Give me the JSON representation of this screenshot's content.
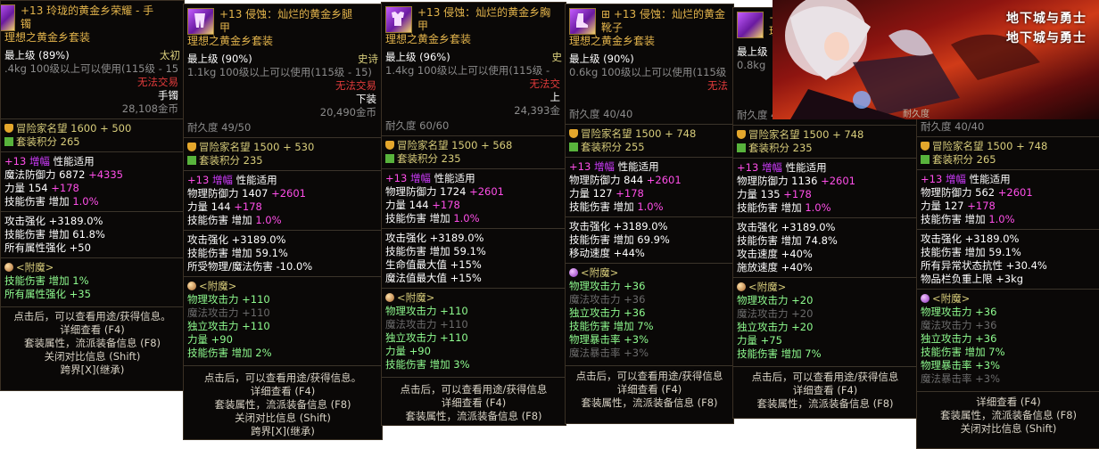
{
  "panels": [
    {
      "title_lines": [
        "+13 玲珑的黄金乡荣耀 - 手",
        "镯"
      ],
      "set_name": "理想之黄金乡套装",
      "level": "最上级 (89%)",
      "rarity": "太初",
      "weight": ".4kg",
      "req": "100级以上可以使用(115级 - 15",
      "trade": "无法交易",
      "slot": "手镯",
      "price": "28,108金币",
      "fame": "冒险家名望 1600 + 500",
      "set_score": "套装积分 265",
      "amp_plus": "+13",
      "amp_label": "增幅",
      "perf": "性能适用",
      "stats": [
        {
          "label": "魔法防御力 6872 ",
          "bonus": "+4335"
        },
        {
          "label": "力量 154 ",
          "bonus": "+178"
        },
        {
          "label": "技能伤害 增加 ",
          "bonus": "1.0%"
        }
      ],
      "effects": [
        "攻击强化 +3189.0%",
        "技能伤害 增加 61.8%",
        "所有属性强化 +50"
      ],
      "enchant_title": "<附魔>",
      "enchants": [
        {
          "text": "技能伤害 增加 1%",
          "dim": false
        },
        {
          "text": "所有属性强化 +35",
          "dim": false
        }
      ],
      "footer": [
        "点击后，可以查看用途/获得信息。",
        "详细查看 (F4)",
        "套装属性，流派装备信息 (F8)",
        "关闭对比信息 (Shift)"
      ],
      "footer_red": "跨界[X](继承)"
    },
    {
      "title_lines": [
        "+13 侵蚀：灿烂的黄金乡腿",
        "甲"
      ],
      "set_name": "理想之黄金乡套装",
      "level": "最上级 (90%)",
      "rarity": "史诗",
      "weight": "1.1kg",
      "req": "100级以上可以使用(115级 - 15)",
      "trade": "无法交易",
      "slot": "下装",
      "price": "20,490金币",
      "durability": "耐久度 49/50",
      "fame": "冒险家名望 1500 + 530",
      "set_score": "套装积分 235",
      "amp_plus": "+13",
      "amp_label": "增幅",
      "perf": "性能适用",
      "stats": [
        {
          "label": "物理防御力 1407 ",
          "bonus": "+2601"
        },
        {
          "label": "力量 144 ",
          "bonus": "+178"
        },
        {
          "label": "技能伤害 增加 ",
          "bonus": "1.0%"
        }
      ],
      "effects": [
        "攻击强化 +3189.0%",
        "技能伤害 增加 59.1%",
        "所受物理/魔法伤害 -10.0%"
      ],
      "enchant_title": "<附魔>",
      "enchants": [
        {
          "text": "物理攻击力 +110",
          "dim": false
        },
        {
          "text": "魔法攻击力 +110",
          "dim": true
        },
        {
          "text": "独立攻击力 +110",
          "dim": false
        },
        {
          "text": "力量 +90",
          "dim": false
        },
        {
          "text": "技能伤害 增加 2%",
          "dim": false
        }
      ],
      "footer": [
        "点击后，可以查看用途/获得信息。",
        "详细查看 (F4)",
        "套装属性，流派装备信息 (F8)",
        "关闭对比信息 (Shift)"
      ],
      "footer_red": "跨界[X](继承)"
    },
    {
      "title_lines": [
        "+13 侵蚀：灿烂的黄金乡胸",
        "甲"
      ],
      "set_name": "理想之黄金乡套装",
      "level": "最上级 (96%)",
      "rarity": "史",
      "weight": "1.4kg",
      "req": "100级以上可以使用(115级 -",
      "trade": "无法交",
      "slot": "上",
      "price": "24,393金",
      "durability": "耐久度 60/60",
      "fame": "冒险家名望 1500 + 568",
      "set_score": "套装积分 235",
      "amp_plus": "+13",
      "amp_label": "增幅",
      "perf": "性能适用",
      "stats": [
        {
          "label": "物理防御力 1724 ",
          "bonus": "+2601"
        },
        {
          "label": "力量 144 ",
          "bonus": "+178"
        },
        {
          "label": "技能伤害 增加 ",
          "bonus": "1.0%"
        }
      ],
      "effects": [
        "攻击强化 +3189.0%",
        "技能伤害 增加 59.1%",
        "生命值最大值 +15%",
        "魔法值最大值 +15%"
      ],
      "enchant_title": "<附魔>",
      "enchants": [
        {
          "text": "物理攻击力 +110",
          "dim": false
        },
        {
          "text": "魔法攻击力 +110",
          "dim": true
        },
        {
          "text": "独立攻击力 +110",
          "dim": false
        },
        {
          "text": "力量 +90",
          "dim": false
        },
        {
          "text": "技能伤害 增加 3%",
          "dim": false
        }
      ],
      "footer": [
        "点击后，可以查看用途/获得信息",
        "详细查看 (F4)",
        "套装属性，流派装备信息 (F8)"
      ],
      "footer_red": ""
    },
    {
      "title_lines": [
        "⊞ +13 侵蚀：灿烂的黄金",
        "靴子"
      ],
      "set_name": "理想之黄金乡套装",
      "level": "最上级 (90%)",
      "rarity": "",
      "weight": "0.6kg",
      "req": "100级以上可以使用(115级",
      "trade": "无法",
      "slot": "",
      "price": "",
      "durability": "耐久度 40/40",
      "fame": "冒险家名望 1500 + 748",
      "set_score": "套装积分 255",
      "amp_plus": "+13",
      "amp_label": "增幅",
      "perf": "性能适用",
      "stats": [
        {
          "label": "物理防御力 844 ",
          "bonus": "+2601"
        },
        {
          "label": "力量 127 ",
          "bonus": "+178"
        },
        {
          "label": "技能伤害 增加 ",
          "bonus": "1.0%"
        }
      ],
      "effects": [
        "攻击强化 +3189.0%",
        "技能伤害 增加 69.9%",
        "移动速度 +44%"
      ],
      "enchant_title": "<附魔>",
      "enchants": [
        {
          "text": "物理攻击力 +36",
          "dim": false
        },
        {
          "text": "魔法攻击力 +36",
          "dim": true
        },
        {
          "text": "独立攻击力 +36",
          "dim": false
        },
        {
          "text": "技能伤害 增加 7%",
          "dim": false
        },
        {
          "text": "物理暴击率 +3%",
          "dim": false
        },
        {
          "text": "魔法暴击率 +3%",
          "dim": true
        }
      ],
      "footer": [
        "点击后，可以查看用途/获得信息",
        "详细查看 (F4)",
        "套装属性，流派装备信息 (F8)"
      ],
      "footer_red": ""
    },
    {
      "title_lines": [
        "+",
        "理"
      ],
      "set_name": "",
      "level": "最上级",
      "rarity": "",
      "weight": "0.8kg",
      "req": "",
      "trade": "无法",
      "slot": "",
      "price": "",
      "durability": "耐久度 48/48",
      "fame": "冒险家名望 1500 + 748",
      "set_score": "套装积分 235",
      "amp_plus": "+13",
      "amp_label": "增幅",
      "perf": "性能适用",
      "stats": [
        {
          "label": "物理防御力 1136 ",
          "bonus": "+2601"
        },
        {
          "label": "力量 135 ",
          "bonus": "+178"
        },
        {
          "label": "技能伤害 增加 ",
          "bonus": "1.0%"
        }
      ],
      "effects": [
        "攻击强化 +3189.0%",
        "技能伤害 增加 74.8%",
        "攻击速度 +40%",
        "施放速度 +40%"
      ],
      "enchant_title": "<附魔>",
      "enchants": [
        {
          "text": "物理攻击力 +20",
          "dim": false
        },
        {
          "text": "魔法攻击力 +20",
          "dim": true
        },
        {
          "text": "独立攻击力 +20",
          "dim": false
        },
        {
          "text": "力量 +75",
          "dim": false
        },
        {
          "text": "技能伤害 增加 7%",
          "dim": false
        }
      ],
      "footer": [
        "点击后，可以查看用途/获得信息",
        "详细查看 (F4)",
        "套装属性，流派装备信息 (F8)"
      ],
      "footer_red": ""
    },
    {
      "title_lines": [],
      "set_name": "",
      "level": "",
      "rarity": "",
      "weight": "",
      "req": "",
      "trade": "",
      "slot": "",
      "price": "",
      "durability": "耐久度 40/40",
      "fame": "冒险家名望 1500 + 748",
      "set_score": "套装积分 265",
      "amp_plus": "+13",
      "amp_label": "增幅",
      "perf": "性能适用",
      "stats": [
        {
          "label": "物理防御力 562 ",
          "bonus": "+2601"
        },
        {
          "label": "力量 127 ",
          "bonus": "+178"
        },
        {
          "label": "技能伤害 增加 ",
          "bonus": "1.0%"
        }
      ],
      "effects": [
        "攻击强化 +3189.0%",
        "技能伤害 增加 59.1%",
        "所有异常状态抗性 +30.4%",
        "物品栏负重上限 +3kg"
      ],
      "enchant_title": "<附魔>",
      "enchants": [
        {
          "text": "物理攻击力 +36",
          "dim": false
        },
        {
          "text": "魔法攻击力 +36",
          "dim": true
        },
        {
          "text": "独立攻击力 +36",
          "dim": false
        },
        {
          "text": "技能伤害 增加 7%",
          "dim": false
        },
        {
          "text": "物理暴击率 +3%",
          "dim": false
        },
        {
          "text": "魔法暴击率 +3%",
          "dim": true
        }
      ],
      "footer": [
        "详细查看 (F4)",
        "套装属性，流派装备信息 (F8)",
        "关闭对比信息 (Shift)"
      ],
      "footer_red": ""
    }
  ],
  "banner": {
    "logo_lines": [
      "地下城与勇士",
      "地下城与勇士"
    ],
    "durability_peek": "耐久度"
  }
}
